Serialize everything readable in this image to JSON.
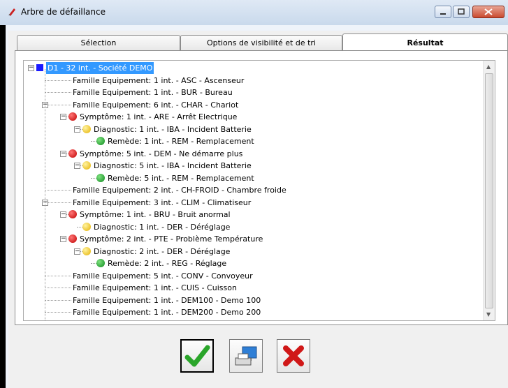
{
  "window": {
    "title": "Arbre de défaillance"
  },
  "tabs": [
    {
      "label": "Sélection",
      "active": false
    },
    {
      "label": "Options de visibilité et de tri",
      "active": false
    },
    {
      "label": "Résultat",
      "active": true
    }
  ],
  "tree": [
    {
      "level": 0,
      "icon": "blue-square",
      "expander": "minus",
      "label": "D1 - 32 int. - Société DEMO",
      "selected": true
    },
    {
      "level": 1,
      "icon": "none",
      "expander": "none",
      "label": "Famille Equipement: 1 int. - ASC - Ascenseur"
    },
    {
      "level": 1,
      "icon": "none",
      "expander": "none",
      "label": "Famille Equipement: 1 int. - BUR - Bureau"
    },
    {
      "level": 1,
      "icon": "none",
      "expander": "minus",
      "label": "Famille Equipement: 6 int. - CHAR - Chariot"
    },
    {
      "level": 2,
      "icon": "red",
      "expander": "minus",
      "label": "Symptôme: 1 int. - ARE - Arrêt Electrique"
    },
    {
      "level": 3,
      "icon": "yellow",
      "expander": "minus",
      "label": "Diagnostic: 1 int. - IBA - Incident Batterie"
    },
    {
      "level": 4,
      "icon": "green",
      "expander": "none",
      "label": "Remède: 1 int. - REM - Remplacement"
    },
    {
      "level": 2,
      "icon": "red",
      "expander": "minus",
      "label": "Symptôme: 5 int. - DEM - Ne démarre plus"
    },
    {
      "level": 3,
      "icon": "yellow",
      "expander": "minus",
      "label": "Diagnostic: 5 int. - IBA - Incident Batterie"
    },
    {
      "level": 4,
      "icon": "green",
      "expander": "none",
      "label": "Remède: 5 int. - REM - Remplacement"
    },
    {
      "level": 1,
      "icon": "none",
      "expander": "none",
      "label": "Famille Equipement: 2 int. - CH-FROID - Chambre froide"
    },
    {
      "level": 1,
      "icon": "none",
      "expander": "minus",
      "label": "Famille Equipement: 3 int. - CLIM - Climatiseur"
    },
    {
      "level": 2,
      "icon": "red",
      "expander": "minus",
      "label": "Symptôme: 1 int. - BRU - Bruit anormal"
    },
    {
      "level": 3,
      "icon": "yellow",
      "expander": "none",
      "label": "Diagnostic: 1 int. - DER - Déréglage"
    },
    {
      "level": 2,
      "icon": "red",
      "expander": "minus",
      "label": "Symptôme: 2 int. - PTE - Problème Température"
    },
    {
      "level": 3,
      "icon": "yellow",
      "expander": "minus",
      "label": "Diagnostic: 2 int. - DER - Déréglage"
    },
    {
      "level": 4,
      "icon": "green",
      "expander": "none",
      "label": "Remède: 2 int. - REG - Réglage"
    },
    {
      "level": 1,
      "icon": "none",
      "expander": "none",
      "label": "Famille Equipement: 5 int. - CONV - Convoyeur"
    },
    {
      "level": 1,
      "icon": "none",
      "expander": "none",
      "label": "Famille Equipement: 1 int. - CUIS - Cuisson"
    },
    {
      "level": 1,
      "icon": "none",
      "expander": "none",
      "label": "Famille Equipement: 1 int. - DEM100 - Demo 100"
    },
    {
      "level": 1,
      "icon": "none",
      "expander": "none",
      "label": "Famille Equipement: 1 int. - DEM200 - Demo 200"
    }
  ],
  "buttons": {
    "ok_icon": "green-checkmark-icon",
    "print_icon": "printer-monitor-icon",
    "cancel_icon": "red-x-icon"
  }
}
